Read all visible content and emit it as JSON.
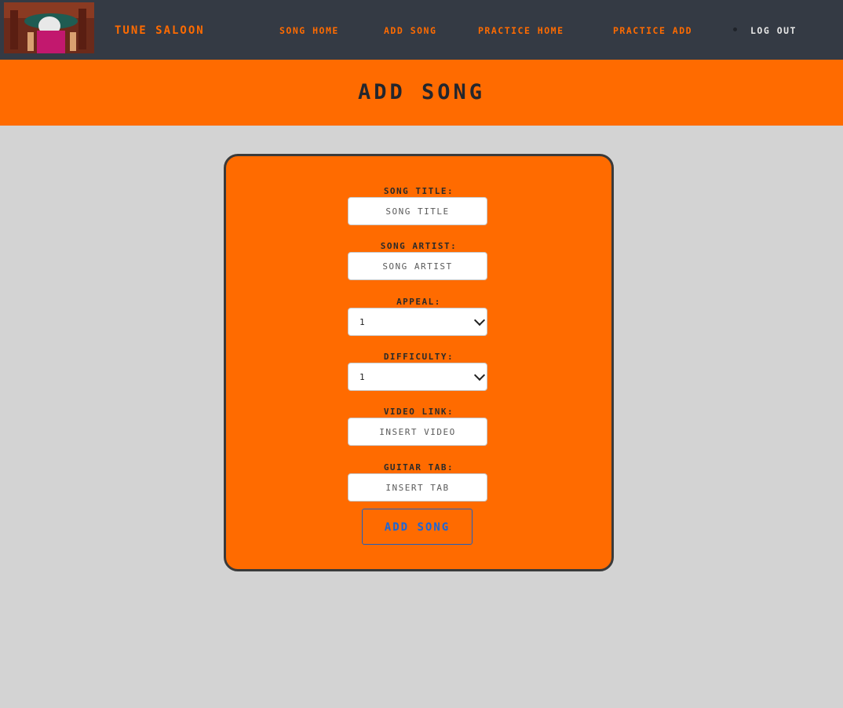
{
  "header": {
    "brand": "TUNE SALOON",
    "nav": [
      {
        "label": "SONG HOME"
      },
      {
        "label": "ADD SONG"
      },
      {
        "label": "PRACTICE HOME"
      },
      {
        "label": "PRACTICE ADD"
      },
      {
        "label": "LOG OUT"
      }
    ]
  },
  "page": {
    "title": "ADD SONG"
  },
  "form": {
    "title": {
      "label": "SONG TITLE:",
      "placeholder": "SONG TITLE"
    },
    "artist": {
      "label": "SONG ARTIST:",
      "placeholder": "SONG ARTIST"
    },
    "appeal": {
      "label": "APPEAL:",
      "value": "1"
    },
    "difficulty": {
      "label": "DIFFICULTY:",
      "value": "1"
    },
    "video": {
      "label": "VIDEO LINK:",
      "placeholder": "INSERT VIDEO"
    },
    "tab": {
      "label": "GUITAR TAB:",
      "placeholder": "INSERT TAB"
    },
    "submit_label": "ADD SONG"
  },
  "colors": {
    "accent": "#ff6b00",
    "header_bg": "#343a44",
    "page_bg": "#d3d3d3"
  }
}
